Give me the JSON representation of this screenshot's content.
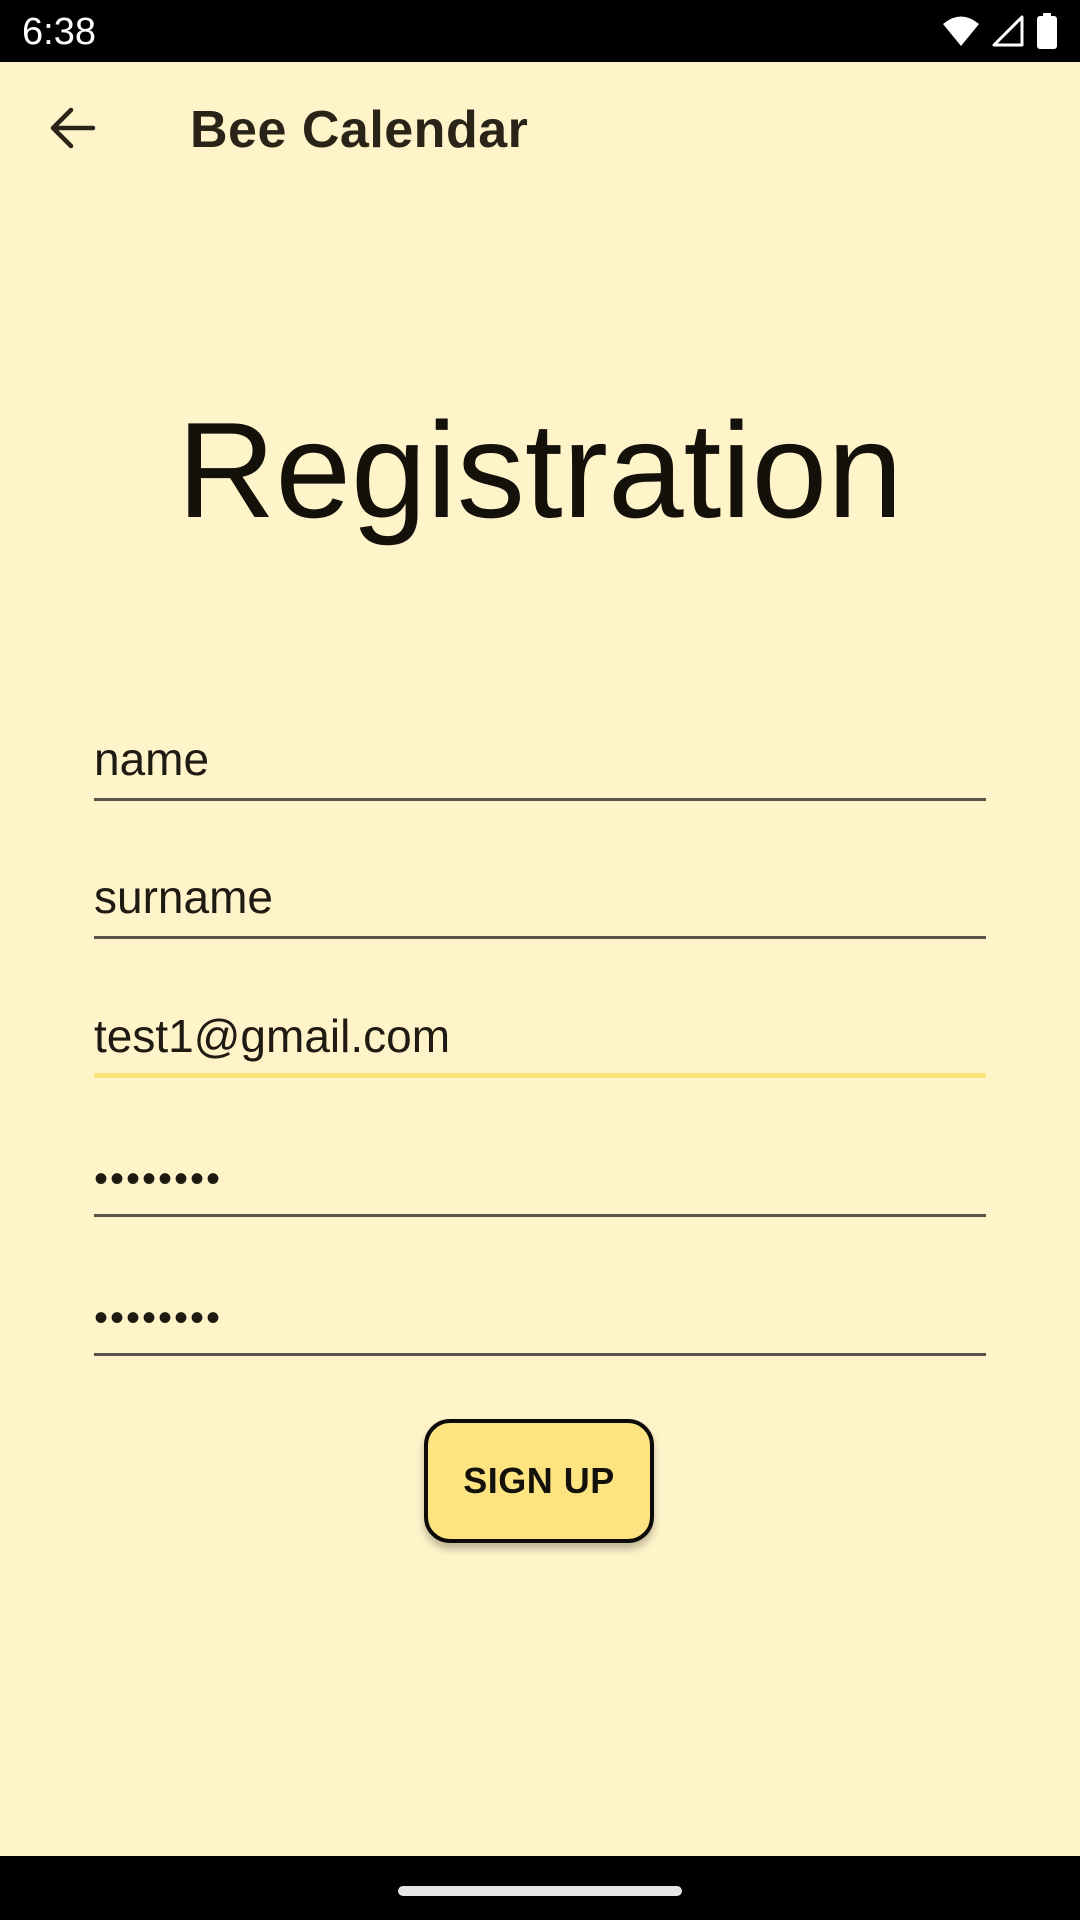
{
  "status_bar": {
    "time": "6:38",
    "icons": [
      "wifi-icon",
      "cell-signal-icon",
      "battery-icon"
    ]
  },
  "app_bar": {
    "back_icon": "arrow-back-icon",
    "title": "Bee Calendar"
  },
  "page": {
    "title": "Registration"
  },
  "form": {
    "fields": [
      {
        "name": "name-field",
        "value": "name",
        "type": "text",
        "focused": false
      },
      {
        "name": "surname-field",
        "value": "surname",
        "type": "text",
        "focused": false
      },
      {
        "name": "email-field",
        "value": "test1@gmail.com",
        "type": "email",
        "focused": true
      },
      {
        "name": "password-field",
        "value": "••••••••",
        "type": "password",
        "focused": false
      },
      {
        "name": "confirm-password-field",
        "value": "••••••••",
        "type": "password",
        "focused": false
      }
    ],
    "submit_label": "SIGN UP"
  },
  "colors": {
    "background": "#FFF3CA",
    "button_fill": "#FDE480",
    "focus_underline": "#FBE37A",
    "underline": "#5A5548",
    "system_bars": "#000000"
  }
}
